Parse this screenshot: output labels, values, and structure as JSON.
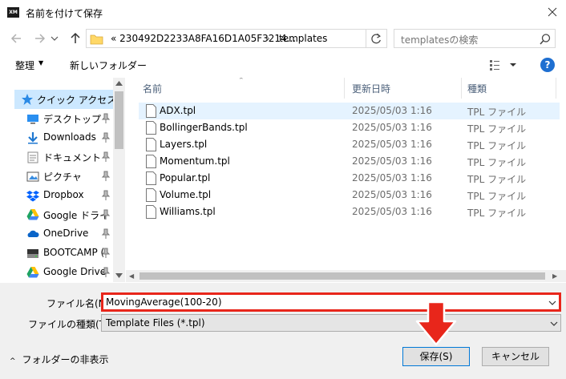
{
  "window": {
    "app_icon_text": "XM",
    "title": "名前を付けて保存"
  },
  "address": {
    "path_prefix": "«",
    "crumb1": "230492D2233A8FA16D1A05F3214...",
    "separator": "›",
    "crumb2": "templates"
  },
  "search": {
    "placeholder": "templatesの検索"
  },
  "toolbar": {
    "organize_label": "整理",
    "new_folder_label": "新しいフォルダー",
    "help_label": "?"
  },
  "sidebar": {
    "items": [
      {
        "label": "クイック アクセス",
        "icon": "star-icon",
        "pinned": false,
        "selected": true
      },
      {
        "label": "デスクトップ",
        "icon": "desktop-icon",
        "pinned": true
      },
      {
        "label": "Downloads",
        "icon": "download-icon",
        "pinned": true
      },
      {
        "label": "ドキュメント",
        "icon": "documents-icon",
        "pinned": true
      },
      {
        "label": "ピクチャ",
        "icon": "pictures-icon",
        "pinned": true
      },
      {
        "label": "Dropbox",
        "icon": "dropbox-icon",
        "pinned": true
      },
      {
        "label": "Google ドライ",
        "icon": "google-drive-icon",
        "pinned": true
      },
      {
        "label": "OneDrive",
        "icon": "onedrive-icon",
        "pinned": true
      },
      {
        "label": "BOOTCAMP (",
        "icon": "drive-icon",
        "pinned": true
      },
      {
        "label": "Google Drive",
        "icon": "google-drive-icon",
        "pinned": true
      }
    ]
  },
  "columns": {
    "name": "名前",
    "date": "更新日時",
    "type": "種類"
  },
  "files": [
    {
      "name": "ADX.tpl",
      "date": "2025/05/03 1:16",
      "type": "TPL ファイル"
    },
    {
      "name": "BollingerBands.tpl",
      "date": "2025/05/03 1:16",
      "type": "TPL ファイル"
    },
    {
      "name": "Layers.tpl",
      "date": "2025/05/03 1:16",
      "type": "TPL ファイル"
    },
    {
      "name": "Momentum.tpl",
      "date": "2025/05/03 1:16",
      "type": "TPL ファイル"
    },
    {
      "name": "Popular.tpl",
      "date": "2025/05/03 1:16",
      "type": "TPL ファイル"
    },
    {
      "name": "Volume.tpl",
      "date": "2025/05/03 1:16",
      "type": "TPL ファイル"
    },
    {
      "name": "Williams.tpl",
      "date": "2025/05/03 1:16",
      "type": "TPL ファイル"
    }
  ],
  "form": {
    "filename_label": "ファイル名(N):",
    "filename_value": "MovingAverage(100-20)",
    "filetype_label": "ファイルの種類(T):",
    "filetype_value": "Template Files (*.tpl)"
  },
  "footer": {
    "hide_folders_label": "フォルダーの非表示",
    "save_label": "保存(S)",
    "cancel_label": "キャンセル"
  },
  "colors": {
    "highlight_border": "#e8261b",
    "arrow": "#e8261b",
    "selection": "#cce8ff",
    "accent": "#0078d7"
  }
}
